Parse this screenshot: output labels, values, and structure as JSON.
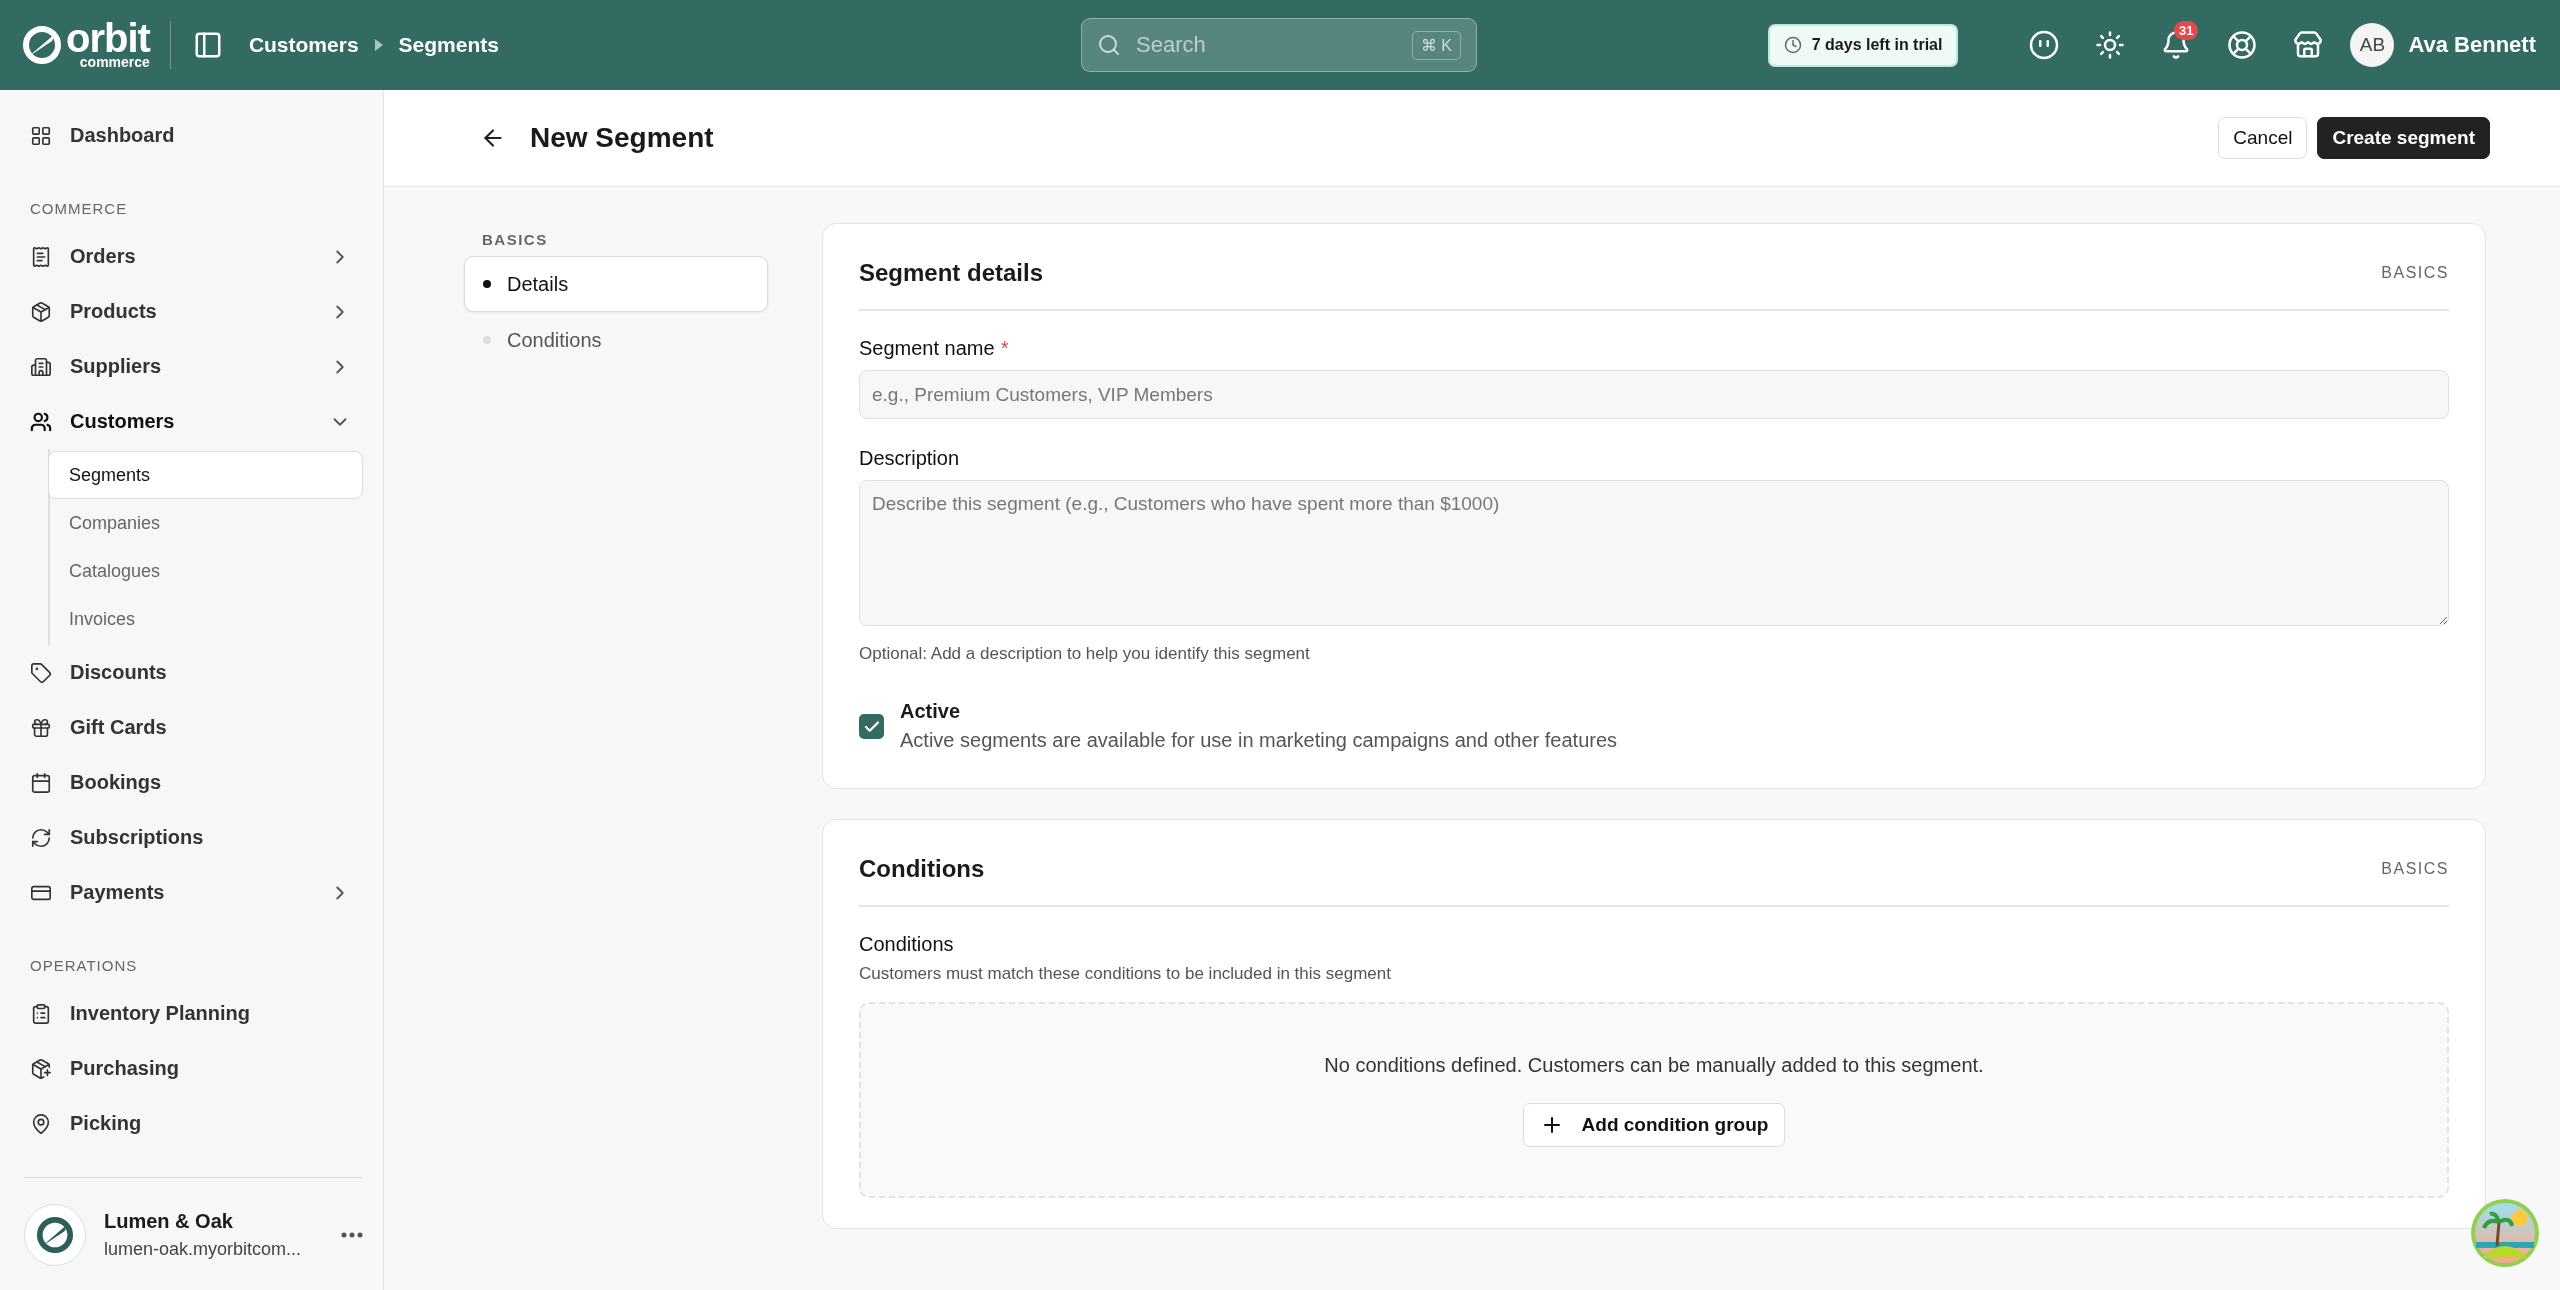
{
  "topbar": {
    "logo": {
      "wordmark": "orbit",
      "subtitle": "commerce"
    },
    "breadcrumb": [
      "Customers",
      "Segments"
    ],
    "search": {
      "placeholder": "Search",
      "shortcut": "⌘ K"
    },
    "trial_badge": "7 days left in trial",
    "notification_count": "31",
    "user": {
      "initials": "AB",
      "name": "Ava Bennett"
    }
  },
  "sidebar": {
    "groups": [
      {
        "items": [
          {
            "label": "Dashboard",
            "selected": false
          }
        ]
      },
      {
        "heading": "COMMERCE",
        "items": [
          {
            "label": "Orders",
            "selected": false,
            "expanded": false
          },
          {
            "label": "Products",
            "selected": false,
            "expanded": false
          },
          {
            "label": "Suppliers",
            "selected": false,
            "expanded": false
          },
          {
            "label": "Customers",
            "selected": true,
            "expanded": true,
            "children": [
              {
                "label": "Segments",
                "selected": true
              },
              {
                "label": "Companies",
                "selected": false
              },
              {
                "label": "Catalogues",
                "selected": false
              },
              {
                "label": "Invoices",
                "selected": false
              }
            ]
          },
          {
            "label": "Discounts",
            "selected": false
          },
          {
            "label": "Gift Cards",
            "selected": false
          },
          {
            "label": "Bookings",
            "selected": false
          },
          {
            "label": "Subscriptions",
            "selected": false
          },
          {
            "label": "Payments",
            "selected": false,
            "expanded": false
          }
        ]
      },
      {
        "heading": "OPERATIONS",
        "items": [
          {
            "label": "Inventory Planning",
            "selected": false
          },
          {
            "label": "Purchasing",
            "selected": false
          },
          {
            "label": "Picking",
            "selected": false
          }
        ]
      }
    ],
    "store": {
      "name": "Lumen & Oak",
      "url": "lumen-oak.myorbitcom..."
    }
  },
  "header": {
    "title": "New Segment",
    "buttons": [
      {
        "label": "Cancel",
        "kind": "secondary"
      },
      {
        "label": "Create segment",
        "kind": "primary"
      }
    ]
  },
  "section_nav": {
    "heading": "BASICS",
    "items": [
      {
        "label": "Details",
        "selected": true
      },
      {
        "label": "Conditions",
        "selected": false
      }
    ]
  },
  "details_card": {
    "title": "Segment details",
    "tag": "BASICS",
    "name_field": {
      "label": "Segment name",
      "required": true,
      "required_mark": "*",
      "placeholder": "e.g., Premium Customers, VIP Members"
    },
    "description_field": {
      "label": "Description",
      "placeholder": "Describe this segment (e.g., Customers who have spent more than $1000)",
      "help": "Optional: Add a description to help you identify this segment"
    },
    "active": {
      "label": "Active",
      "description": "Active segments are available for use in marketing campaigns and other features",
      "checked": true
    }
  },
  "conditions_card": {
    "title": "Conditions",
    "tag": "BASICS",
    "label": "Conditions",
    "description": "Customers must match these conditions to be included in this segment",
    "empty_text": "No conditions defined. Customers can be manually added to this segment.",
    "add_button": "Add condition group"
  }
}
